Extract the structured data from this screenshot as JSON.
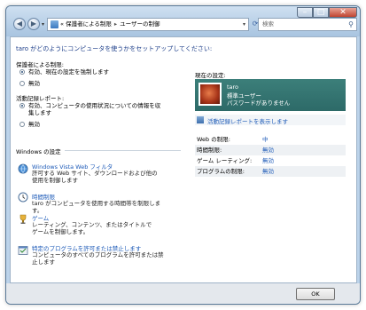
{
  "address_bar": {
    "segments": [
      "保護者による制限",
      "ユーザーの制御"
    ],
    "separator": "▸"
  },
  "search": {
    "placeholder": "検索"
  },
  "heading": "taro がどのようにコンピュータを使うかをセットアップしてください:",
  "parental_controls": {
    "label": "保護者による制限:",
    "options": [
      "有効、現在の設定を強制します",
      "無効"
    ],
    "selected_index": 0
  },
  "activity_reporting": {
    "label": "活動記録レポート:",
    "options": [
      "有効、コンピュータの使用状況についての情報を収集します",
      "無効"
    ],
    "selected_index": 0
  },
  "windows_settings": {
    "label": "Windows の設定",
    "items": [
      {
        "link": "Windows Vista Web フィルタ",
        "desc": "許可する Web サイト、ダウンロードおよび他の使用を制御します"
      },
      {
        "link": "時間制限",
        "desc": "taro がコンピュータを使用する時間帯を制限します。"
      },
      {
        "link": "ゲーム",
        "desc": "レーティング、コンテンツ、またはタイトルでゲームを制御します。"
      },
      {
        "link": "特定のプログラムを許可または禁止します",
        "desc": "コンピュータのすべてのプログラムを許可または禁止します"
      }
    ]
  },
  "current_settings": {
    "label": "現在の設定:",
    "user": {
      "name": "taro",
      "role": "標準ユーザー",
      "password": "パスワードがありません"
    },
    "report_link": "活動記録レポートを表示します",
    "rows": [
      {
        "key": "Web の制限:",
        "value": "中"
      },
      {
        "key": "時間制限:",
        "value": "無効"
      },
      {
        "key": "ゲーム レーティング:",
        "value": "無効"
      },
      {
        "key": "プログラムの制限:",
        "value": "無効"
      }
    ]
  },
  "footer": {
    "ok_label": "OK"
  },
  "colors": {
    "link": "#1e5bb8",
    "heading": "#1e3f8a",
    "user_panel": "#2d6a68"
  }
}
